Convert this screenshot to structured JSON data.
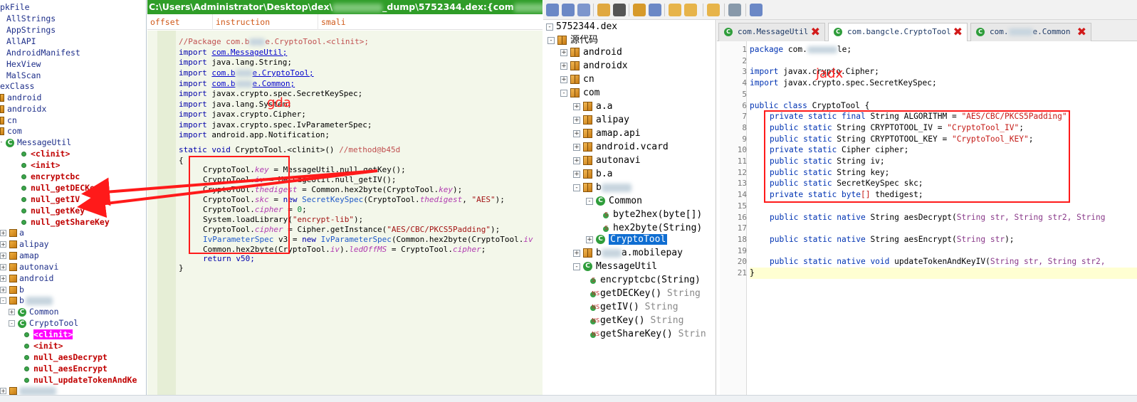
{
  "gda": {
    "title_prefix": "C:\\Users\\Administrator\\Desktop\\dex\\",
    "title_suffix": "_dump\\5752344.dex:{com",
    "title_tail": "Ci",
    "header": {
      "offset": "offset",
      "instruction": "instruction",
      "smali": "smali"
    },
    "label": "gda",
    "tree": {
      "items": {
        "apk_file": "pkFile",
        "all_strings": "AllStrings",
        "app_strings": "AppStrings",
        "all_api": "AllAPI",
        "android_manifest": "AndroidManifest",
        "hex_view": "HexView",
        "mal_scan": "MalScan",
        "dex_class": "exClass",
        "android": "android",
        "androidx": "androidx",
        "cn": "cn",
        "com": "com",
        "message_util": "MessageUtil",
        "mu_clinit": "<clinit>",
        "mu_init": "<init>",
        "mu_encryptcbc": "encryptcbc",
        "mu_null_getdeckey": "null_getDECKey",
        "mu_null_getiv": "null_getIV",
        "mu_null_getkey": "null_getKey",
        "mu_null_getsharekey": "null_getShareKey",
        "pkg_a": "a",
        "pkg_alipay": "alipay",
        "pkg_amap": "amap",
        "pkg_autonavi": "autonavi",
        "pkg_android2": "android",
        "pkg_b": "b",
        "pkg_b2": "b",
        "common": "Common",
        "crypto_tool": "CryptoTool",
        "ct_clinit": "<clinit>",
        "ct_init": "<init>",
        "ct_null_aesdecrypt": "null_aesDecrypt",
        "ct_null_aesencrypt": "null_aesEncrypt",
        "ct_null_updatetokenandkeyiv": "null_updateTokenAndKe"
      }
    },
    "code": {
      "l1": "//Package com.b",
      "l1b": "e.CryptoTool.<clinit>;",
      "import_kw": "import",
      "l2": "com.MessageUtil;",
      "l3": "java.lang.String;",
      "l4a": "com.b",
      "l4b": "e.CryptoTool;",
      "l5a": "com.b",
      "l5b": "e.Common;",
      "l6": "javax.crypto.spec.SecretKeySpec;",
      "l7": "java.lang.System;",
      "l8": "javax.crypto.Cipher;",
      "l9": "javax.crypto.spec.IvParameterSpec;",
      "l10": "android.app.Notification;",
      "sig_kw": "static void",
      "sig_name": "CryptoTool.<clinit>()",
      "sig_comment": "//method@b45d",
      "brace_open": "{",
      "s1a": "CryptoTool.",
      "s1f": "key",
      "s1b": " = MessageUtil.null_getKey();",
      "s2a": "CryptoTool.",
      "s2f": "iv",
      "s2b": " = MessageUtil.null_getIV();",
      "s3a": "CryptoTool.",
      "s3f": "thedigest",
      "s3b": " = Common.hex2byte(CryptoTool.",
      "s3c": "key",
      "s3d": ");",
      "s4a": "CryptoTool.",
      "s4f": "skc",
      "s4b": " = ",
      "s4k": "new",
      "s4t": " SecretKeySpec",
      "s4c": "(CryptoTool.",
      "s4g": "thedigest",
      "s4d": ", ",
      "s4s": "\"AES\"",
      "s4e": ");",
      "s5a": "CryptoTool.",
      "s5f": "cipher",
      "s5b": " = ",
      "s5n": "0",
      "s5e": ";",
      "s6a": "System.loadLibrary(",
      "s6s": "\"encrypt-lib\"",
      "s6e": ");",
      "s7a": "CryptoTool.",
      "s7f": "cipher",
      "s7b": " = Cipher.getInstance(",
      "s7s": "\"AES/CBC/PKCS5Padding\"",
      "s7e": ");",
      "s8t": "IvParameterSpec",
      "s8a": " v3 = ",
      "s8k": "new",
      "s8t2": " IvParameterSpec",
      "s8b": "(Common.hex2byte(CryptoTool.",
      "s8f": "iv",
      "s9a": "Common.hex2byte(CryptoTool.",
      "s9f": "iv",
      "s9b": ").",
      "s9g": "ledOffMS",
      "s9c": " = CryptoTool.",
      "s9h": "cipher",
      "s9e": ";",
      "s10": "return v50;",
      "brace_close": "}"
    }
  },
  "jadx": {
    "label": "jadx",
    "tree": {
      "root": "5752344.dex",
      "source": "源代码",
      "android": "android",
      "androidx": "androidx",
      "cn": "cn",
      "com": "com",
      "a_a": "a.a",
      "alipay": "alipay",
      "amap_api": "amap.api",
      "android_vcard": "android.vcard",
      "autonavi": "autonavi",
      "b_a": "b.a",
      "b_pkg": "b",
      "common": "Common",
      "byte2hex": "byte2hex(byte[])",
      "hex2byte": "hex2byte(String)",
      "crypto_tool": "CryptoTool",
      "b_mobilepay_prefix": "b",
      "b_mobilepay_suffix": "a.mobilepay",
      "message_util": "MessageUtil",
      "encryptcbc": "encryptcbc(String)",
      "getdeckey": "getDECKey()",
      "getiv": "getIV()",
      "getkey": "getKey()",
      "getsharekey": "getShareKey()",
      "ret_string": "String",
      "ret_strin": "Strin"
    },
    "tabs": {
      "t1": "com.MessageUtil",
      "t2": "com.bangcle.CryptoTool",
      "t3a": "com.",
      "t3b": "e.Common"
    },
    "code": {
      "line_numbers": [
        "1",
        "2",
        "3",
        "4",
        "5",
        "6",
        "7",
        "8",
        "9",
        "10",
        "11",
        "12",
        "13",
        "14",
        "15",
        "16",
        "17",
        "18",
        "19",
        "20",
        "21"
      ],
      "l1k": "package",
      "l1a": " com.",
      "l1b": "le;",
      "l3k": "import",
      "l3a": " javax.crypto.Cipher;",
      "l4k": "import",
      "l4a": " javax.crypto.spec.SecretKeySpec;",
      "l6k": "public class",
      "l6a": " CryptoTool {",
      "ps": "private static",
      "pus": "public static",
      "psf": "private static final",
      "l7a": " String ALGORITHM = ",
      "l7s": "\"AES/CBC/PKCS5Padding\"",
      "l7e": ";",
      "l8a": " String CRYPTOTOOL_IV = ",
      "l8s": "\"CryptoTool_IV\"",
      "l8e": ";",
      "l9a": " String CRYPTOTOOL_KEY = ",
      "l9s": "\"CryptoTool_KEY\"",
      "l9e": ";",
      "l10a": " Cipher cipher;",
      "l11a": " String iv;",
      "l12a": " String key;",
      "l13a": " SecretKeySpec skc;",
      "l14k": " byte",
      "l14a": "[]",
      "l14b": " thedigest;",
      "pub_native": "public static native",
      "l16a": " String aesDecrypt(",
      "l16b": "String str, String str2, String",
      "l18a": " String aesEncrypt(",
      "l18b": "String str",
      "l18c": ");",
      "pub_native_void": "public static native void",
      "l20a": " updateTokenAndKeyIV(",
      "l20b": "String str, String str2,",
      "l21": "}"
    }
  },
  "colors": {
    "gda_title_bg": "#2f9d28",
    "annotation_red": "#ff1a1a",
    "jadx_selection": "#0f6ed2",
    "method_highlight": "#ff00ff"
  }
}
